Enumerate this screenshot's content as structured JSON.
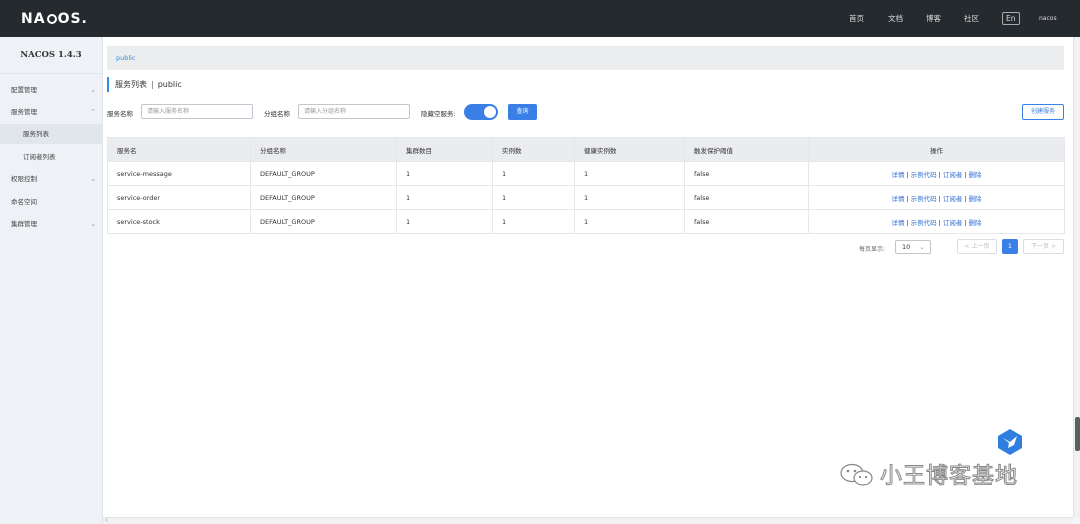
{
  "topbar": {
    "logo_text_left": "NA",
    "logo_text_right": "OS.",
    "nav": [
      "首页",
      "文档",
      "博客",
      "社区"
    ],
    "lang": "En",
    "user": "nacos"
  },
  "sidebar": {
    "title": "NACOS 1.4.3",
    "items": [
      {
        "label": "配置管理",
        "arrow": "⌄"
      },
      {
        "label": "服务管理",
        "arrow": "⌃"
      },
      {
        "label": "服务列表"
      },
      {
        "label": "订阅者列表"
      },
      {
        "label": "权限控制",
        "arrow": "⌄"
      },
      {
        "label": "命名空间"
      },
      {
        "label": "集群管理",
        "arrow": "⌄"
      }
    ]
  },
  "namespace": {
    "current": "public"
  },
  "page": {
    "title": "服务列表",
    "separator": "|",
    "namespace": "public"
  },
  "filters": {
    "service_name_label": "服务名称",
    "service_name_placeholder": "请输入服务名称",
    "group_name_label": "分组名称",
    "group_name_placeholder": "请输入分组名称",
    "hide_empty_label": "隐藏空服务:",
    "hide_empty_on": true,
    "query_button": "查询",
    "create_button": "创建服务"
  },
  "table": {
    "headers": [
      "服务名",
      "分组名称",
      "集群数目",
      "实例数",
      "健康实例数",
      "触发保护阈值",
      "操作"
    ],
    "rows": [
      [
        "service-message",
        "DEFAULT_GROUP",
        "1",
        "1",
        "1",
        "false"
      ],
      [
        "service-order",
        "DEFAULT_GROUP",
        "1",
        "1",
        "1",
        "false"
      ],
      [
        "service-stock",
        "DEFAULT_GROUP",
        "1",
        "1",
        "1",
        "false"
      ]
    ],
    "ops": [
      "详情",
      "示例代码",
      "订阅者",
      "删除"
    ],
    "op_separator": "|"
  },
  "pagination": {
    "page_size_label": "每页显示:",
    "page_size": "10",
    "prev": "< 上一页",
    "current_page": "1",
    "next": "下一页 >"
  },
  "watermark": {
    "text": "小王博客基地"
  },
  "colors": {
    "topbar_bg": "#252a2f",
    "accent": "#3a7fe6",
    "link": "#2f6fd6"
  }
}
